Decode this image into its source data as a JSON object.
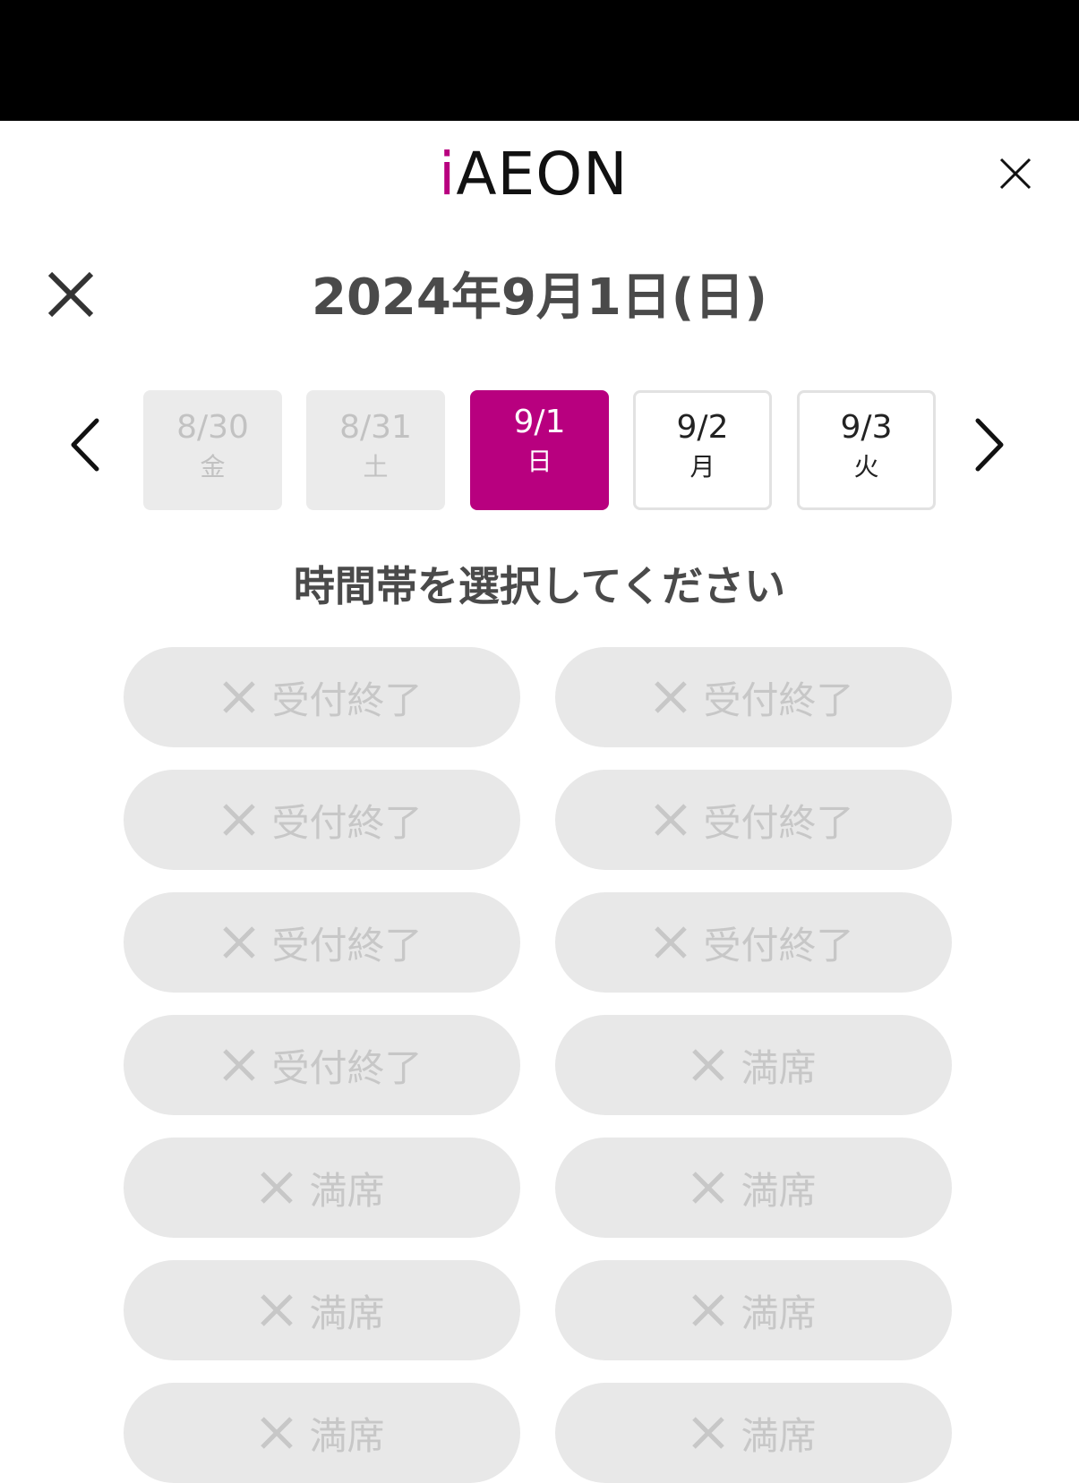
{
  "header": {
    "logo_prefix": "i",
    "logo_rest": "AEON",
    "accent_color": "#b8007f",
    "close_icon": "close-icon"
  },
  "modal": {
    "close_icon": "close-icon",
    "title": "2024年9月1日(日)"
  },
  "date_picker": {
    "prev_icon": "chevron-left-icon",
    "next_icon": "chevron-right-icon",
    "days": [
      {
        "date": "8/30",
        "weekday": "金",
        "state": "disabled"
      },
      {
        "date": "8/31",
        "weekday": "土",
        "state": "disabled"
      },
      {
        "date": "9/1",
        "weekday": "日",
        "state": "selected"
      },
      {
        "date": "9/2",
        "weekday": "月",
        "state": "available"
      },
      {
        "date": "9/3",
        "weekday": "火",
        "state": "available"
      }
    ]
  },
  "instruction": "時間帯を選択してください",
  "slots": [
    {
      "label": "受付終了",
      "icon": "x-icon"
    },
    {
      "label": "受付終了",
      "icon": "x-icon"
    },
    {
      "label": "受付終了",
      "icon": "x-icon"
    },
    {
      "label": "受付終了",
      "icon": "x-icon"
    },
    {
      "label": "受付終了",
      "icon": "x-icon"
    },
    {
      "label": "受付終了",
      "icon": "x-icon"
    },
    {
      "label": "受付終了",
      "icon": "x-icon"
    },
    {
      "label": "満席",
      "icon": "x-icon"
    },
    {
      "label": "満席",
      "icon": "x-icon"
    },
    {
      "label": "満席",
      "icon": "x-icon"
    },
    {
      "label": "満席",
      "icon": "x-icon"
    },
    {
      "label": "満席",
      "icon": "x-icon"
    },
    {
      "label": "満席",
      "icon": "x-icon"
    },
    {
      "label": "満席",
      "icon": "x-icon"
    }
  ]
}
